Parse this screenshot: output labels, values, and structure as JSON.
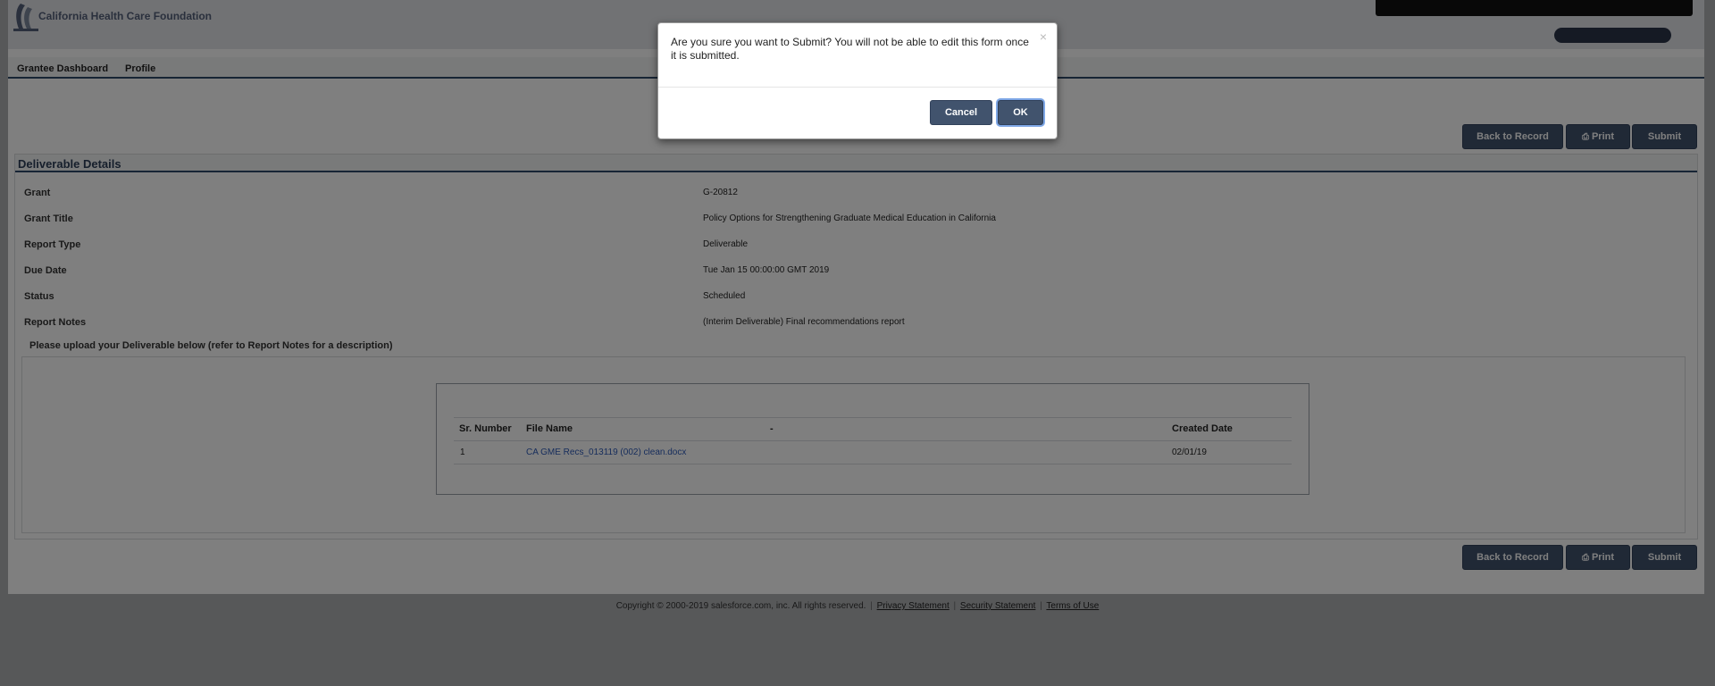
{
  "header": {
    "logo_text": "California Health Care Foundation"
  },
  "nav": {
    "items": [
      "Grantee Dashboard",
      "Profile"
    ]
  },
  "actions": {
    "back_label": "Back to Record",
    "print_label": "Print",
    "submit_label": "Submit"
  },
  "section": {
    "title": "Deliverable Details",
    "fields": [
      {
        "label": "Grant",
        "value": "G-20812"
      },
      {
        "label": "Grant Title",
        "value": "Policy Options for Strengthening Graduate Medical Education in California"
      },
      {
        "label": "Report Type",
        "value": "Deliverable"
      },
      {
        "label": "Due Date",
        "value": "Tue Jan 15 00:00:00 GMT 2019"
      },
      {
        "label": "Status",
        "value": "Scheduled"
      },
      {
        "label": "Report Notes",
        "value": "(Interim Deliverable) Final recommendations report"
      }
    ],
    "upload_prompt": "Please upload your Deliverable below (refer to Report Notes for a description)"
  },
  "files_table": {
    "headers": [
      "Sr. Number",
      "File Name",
      "-",
      "Created Date"
    ],
    "rows": [
      {
        "sr": "1",
        "file": "CA GME Recs_013119 (002) clean.docx",
        "created": "02/01/19"
      }
    ]
  },
  "footer": {
    "copyright": "Copyright © 2000-2019 salesforce.com, inc. All rights reserved.",
    "links": [
      "Privacy Statement",
      "Security Statement",
      "Terms of Use"
    ]
  },
  "modal": {
    "message": "Are you sure you want to Submit? You will not be able to edit this form once it is submitted.",
    "close_glyph": "×",
    "cancel_label": "Cancel",
    "ok_label": "OK"
  },
  "icons": {
    "print": "printer-icon",
    "close": "close-icon"
  }
}
